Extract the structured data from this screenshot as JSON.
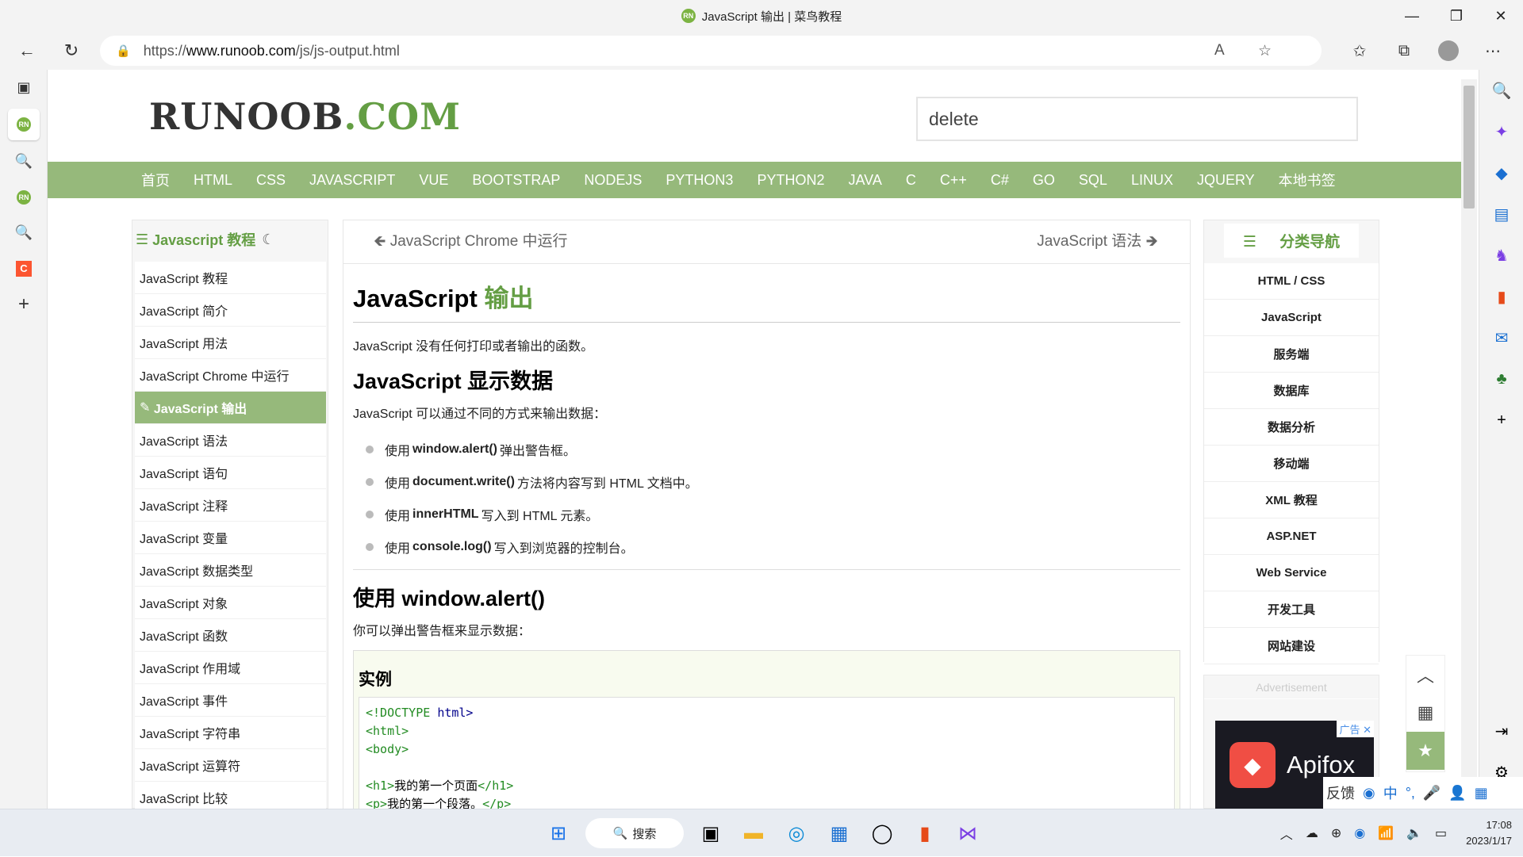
{
  "browser": {
    "tab_title": "JavaScript 输出 | 菜鸟教程",
    "url_prefix": "https://",
    "url_domain": "www.runoob.com",
    "url_path": "/js/js-output.html"
  },
  "site": {
    "logo_main": "RUNOOB",
    "logo_suffix": ".COM",
    "search_value": "delete"
  },
  "topnav": [
    "首页",
    "HTML",
    "CSS",
    "JAVASCRIPT",
    "VUE",
    "BOOTSTRAP",
    "NODEJS",
    "PYTHON3",
    "PYTHON2",
    "JAVA",
    "C",
    "C++",
    "C#",
    "GO",
    "SQL",
    "LINUX",
    "JQUERY",
    "本地书签"
  ],
  "leftmenu": {
    "title": "Javascript 教程",
    "items": [
      "JavaScript 教程",
      "JavaScript 简介",
      "JavaScript 用法",
      "JavaScript Chrome 中运行",
      "JavaScript 输出",
      "JavaScript 语法",
      "JavaScript 语句",
      "JavaScript 注释",
      "JavaScript 变量",
      "JavaScript 数据类型",
      "JavaScript 对象",
      "JavaScript 函数",
      "JavaScript 作用域",
      "JavaScript 事件",
      "JavaScript 字符串",
      "JavaScript 运算符",
      "JavaScript 比较"
    ],
    "active_index": 4
  },
  "article": {
    "prev": "JavaScript Chrome 中运行",
    "next": "JavaScript 语法",
    "h1_a": "JavaScript",
    "h1_b": "输出",
    "intro": "JavaScript 没有任何打印或者输出的函数。",
    "h2_display": "JavaScript 显示数据",
    "p_display": "JavaScript 可以通过不同的方式来输出数据：",
    "bullets": [
      {
        "pre": "使用",
        "code": "window.alert()",
        "post": "弹出警告框。"
      },
      {
        "pre": "使用",
        "code": "document.write()",
        "post": "方法将内容写到 HTML 文档中。"
      },
      {
        "pre": "使用",
        "code": "innerHTML",
        "post": "写入到 HTML 元素。"
      },
      {
        "pre": "使用",
        "code": "console.log()",
        "post": "写入到浏览器的控制台。"
      }
    ],
    "h2_alert": "使用 window.alert()",
    "p_alert": "你可以弹出警告框来显示数据：",
    "example_title": "实例",
    "code": {
      "l1a": "<!DOCTYPE",
      "l1b": "html>",
      "l2": "<html>",
      "l3": "<body>",
      "l5a": "<h1>",
      "l5b": "我的第一个页面",
      "l5c": "</h1>",
      "l6a": "<p>",
      "l6b": "我的第一个段落。",
      "l6c": "</p>"
    }
  },
  "rightnav": {
    "title": "分类导航",
    "items": [
      "HTML / CSS",
      "JavaScript",
      "服务端",
      "数据库",
      "数据分析",
      "移动端",
      "XML 教程",
      "ASP.NET",
      "Web Service",
      "开发工具",
      "网站建设"
    ]
  },
  "ad": {
    "label": "Advertisement",
    "brand": "Apifox",
    "tag": "广告"
  },
  "ime": {
    "feedback": "反馈",
    "lang": "中"
  },
  "taskbar": {
    "search": "搜索",
    "time": "17:08",
    "date": "2023/1/17"
  }
}
